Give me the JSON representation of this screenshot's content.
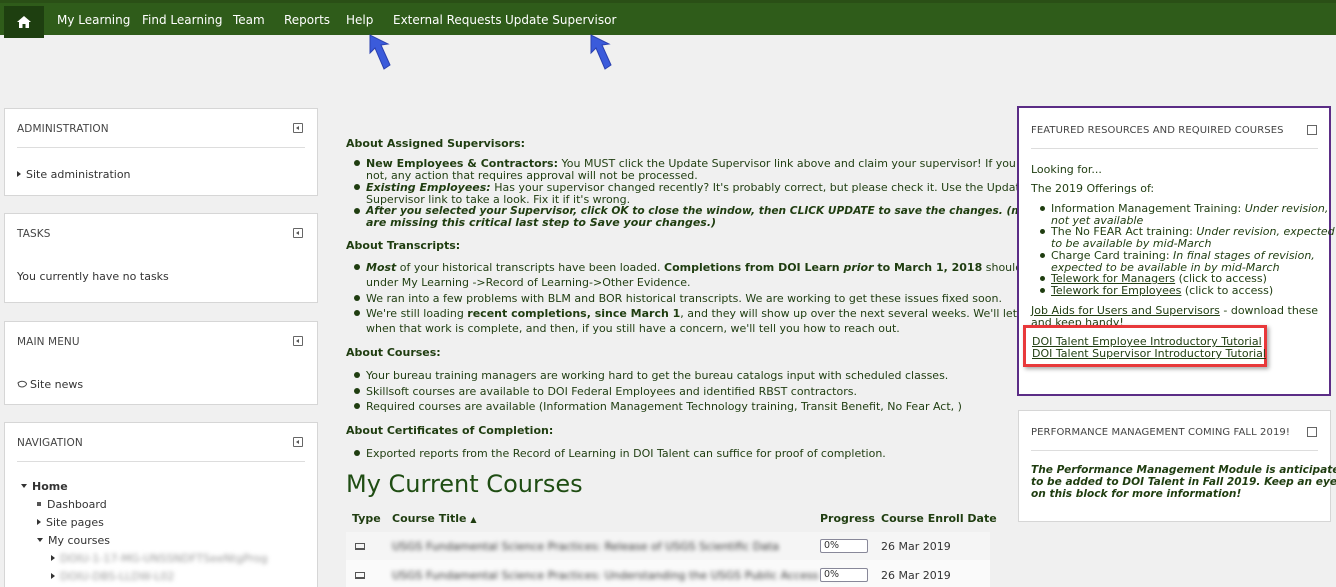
{
  "topnav": {
    "items": [
      "My Learning",
      "Find Learning",
      "Team",
      "Reports",
      "Help",
      "External Requests",
      "Update Supervisor"
    ]
  },
  "left": {
    "administration": {
      "title": "ADMINISTRATION",
      "item": "Site administration"
    },
    "tasks": {
      "title": "TASKS",
      "text": "You currently have no tasks"
    },
    "main_menu": {
      "title": "MAIN MENU",
      "item": "Site news"
    },
    "navigation": {
      "title": "NAVIGATION",
      "home": "Home",
      "dashboard": "Dashboard",
      "site_pages": "Site pages",
      "my_courses": "My courses",
      "course_1": "DOIU-1-17-MG-UNSSNDFTSeeNtgProg",
      "course_2": "DOIU-DBS-LLDW-L02"
    }
  },
  "center": {
    "sup_title": "About Assigned Supervisors:",
    "sup_1a_bold": "New Employees & Contractors:",
    "sup_1a": "  You MUST click the Update Supervisor link above and claim your supervisor!  If you do",
    "sup_1b": "not, any action that requires approval will not be processed.",
    "sup_2a_bold": "Existing Employees:",
    "sup_2a": "  Has your supervisor changed recently? It's probably correct, but please check it.  Use the Update",
    "sup_2b": "Supervisor link to take a look.  Fix it if it's wrong.",
    "sup_3a": "After you selected your Supervisor, click OK to close the window, then CLICK UPDATE to save the changes. (many users",
    "sup_3b": "are missing this critical last step to Save your changes.)",
    "tr_title": "About Transcripts:",
    "tr_1a_i": "Most",
    "tr_1a": " of your historical transcripts have been loaded.  ",
    "tr_1a_b": "Completions from DOI Learn ",
    "tr_1a_bi": "prior",
    "tr_1a_b2": " to March 1, 2018",
    "tr_1a_end": " should show up",
    "tr_1b": "under My Learning ->Record of Learning->Other Evidence.",
    "tr_2": "We ran into a few problems with BLM and BOR historical transcripts.  We are working to get these issues fixed soon.",
    "tr_3a_pre": "We're still loading ",
    "tr_3a_b": "recent completions, since March 1",
    "tr_3a_end": ", and they will show up over the next several weeks. We'll let you know",
    "tr_3b": "when that work is complete, and then, if you still have a concern, we'll tell you how to reach out.",
    "co_title": "About Courses:",
    "co_1": "Your bureau training managers are working hard to get the bureau catalogs input with scheduled classes.",
    "co_2": "Skillsoft courses are available to DOI Federal Employees and identified RBST contractors.",
    "co_3": "Required courses are available (Information Management Technology training, Transit Benefit, No Fear Act, )",
    "ce_title": "About Certificates of Completion:",
    "ce_1": "Exported reports from the Record of Learning in DOI Talent can suffice for proof of completion.",
    "courses_title": "My Current Courses",
    "table": {
      "headers": [
        "Type",
        "Course Title",
        "Progress",
        "Course Enroll Date"
      ],
      "sort_indicator": "▲",
      "rows": [
        {
          "title": "USGS Fundamental Science Practices: Release of USGS Scientific Data",
          "progress": "0%",
          "date": "26 Mar 2019"
        },
        {
          "title": "USGS Fundamental Science Practices: Understanding the USGS Public Access Plan",
          "progress": "0%",
          "date": "26 Mar 2019"
        }
      ]
    }
  },
  "right": {
    "featured": {
      "title": "FEATURED RESOURCES AND REQUIRED COURSES",
      "looking": "Looking for...",
      "offerings": "The 2019 Offerings of:",
      "b1_pre": "Information Management Training: ",
      "b1_i": "Under revision,",
      "b1_i2": "not yet available",
      "b2_pre": "The No FEAR Act training: ",
      "b2_i": "Under revision, expected",
      "b2_i2": "to be available by mid-March",
      "b3_pre": "Charge Card training:  ",
      "b3_i": "In final stages of revision,",
      "b3_i2": "expected to be available in by mid-March",
      "b4_link": "Telework for Managers",
      "b4_rest": " (click to access)",
      "b5_link": "Telework for Employees",
      "b5_rest": " (click to access)",
      "jobaids_link": "Job Aids for Users and Supervisors",
      "jobaids_rest": " - download these",
      "jobaids_2": "and keep handy!",
      "tut_1": "DOI Talent Employee Introductory Tutorial",
      "tut_2": "DOI Talent Supervisor Introductory Tutorial"
    },
    "perf": {
      "title": "PERFORMANCE MANAGEMENT COMING FALL 2019!",
      "l1": "The Performance Management Module is anticipated",
      "l2": "to be added to DOI Talent in Fall 2019.  Keep an eye",
      "l3": "on this block for more information!"
    }
  },
  "colors": {
    "nav_bg": "#2f5c1a",
    "text_green": "#1f3d10",
    "highlight_red": "#e8393b",
    "featured_border": "#5b2d86",
    "arrow_blue": "#3b5bdb"
  }
}
